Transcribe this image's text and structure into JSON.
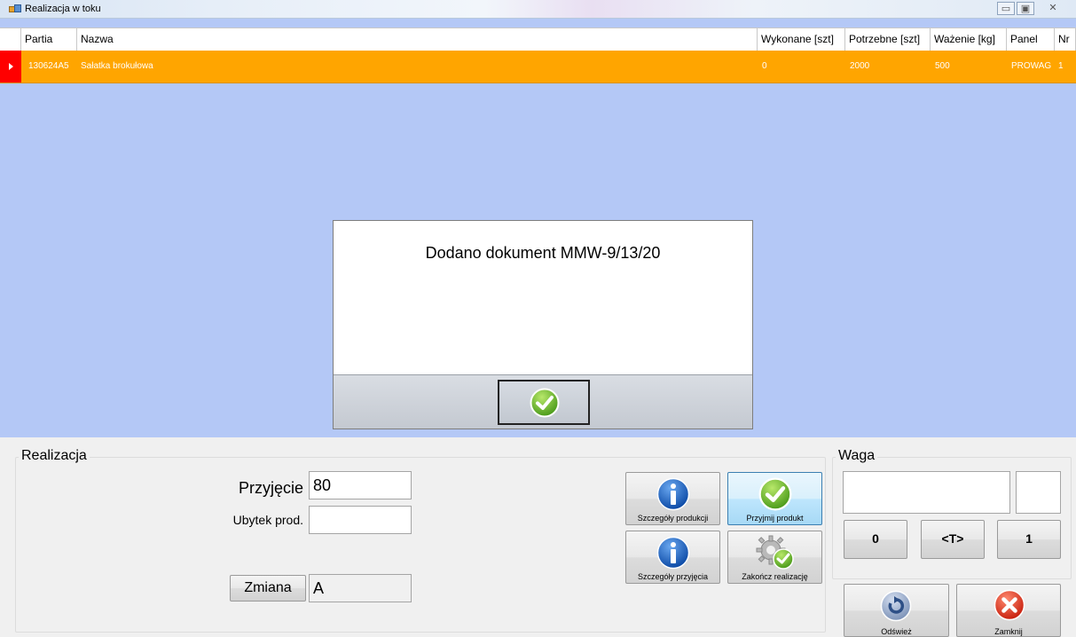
{
  "window": {
    "title": "Realizacja w toku",
    "min_glyph": "▭",
    "max_glyph": "▣",
    "close_glyph": "✕"
  },
  "grid": {
    "columns": [
      "Partia",
      "Nazwa",
      "Wykonane [szt]",
      "Potrzebne [szt]",
      "Ważenie [kg]",
      "Panel",
      "Nr"
    ],
    "rows": [
      {
        "partia": "130624A5",
        "nazwa": "Sałatka brokułowa",
        "wykonane": "0",
        "potrzebne": "2000",
        "wazenie": "500",
        "panel": "PROWAG",
        "nr": "1"
      }
    ],
    "selected_color": "#ffa500",
    "background_color": "#b4c8f6"
  },
  "dialog": {
    "message": "Dodano dokument MMW-9/13/20",
    "ok_icon": "check-icon"
  },
  "realizacja": {
    "title": "Realizacja",
    "przyjecie_label": "Przyjęcie",
    "przyjecie_value": "80",
    "ubytek_label": "Ubytek prod.",
    "ubytek_value": "",
    "zmiana_button": "Zmiana",
    "zmiana_value": "A",
    "buttons": {
      "szczegoly_produkcji": "Szczegóły produkcji",
      "przyjmij_produkt": "Przyjmij produkt",
      "szczegoly_przyjecia": "Szczegóły przyjęcia",
      "zakoncz_realizacje": "Zakończ realizację"
    }
  },
  "waga": {
    "title": "Waga",
    "display_value": "",
    "unit_value": "",
    "zero_button": "0",
    "tare_button": "<T>",
    "one_button": "1",
    "odswiez_button": "Odśwież",
    "zamknij_button": "Zamknij"
  }
}
